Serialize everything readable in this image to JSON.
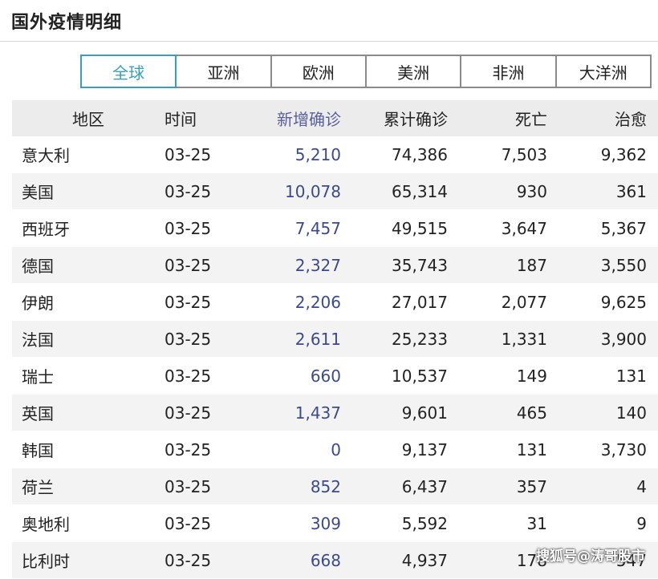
{
  "page": {
    "title": "国外疫情明细"
  },
  "tabs": [
    {
      "label": "全球",
      "active": true
    },
    {
      "label": "亚洲",
      "active": false
    },
    {
      "label": "欧洲",
      "active": false
    },
    {
      "label": "美洲",
      "active": false
    },
    {
      "label": "非洲",
      "active": false
    },
    {
      "label": "大洋洲",
      "active": false
    }
  ],
  "colors": {
    "accent": "#3aa0b8",
    "new_cases": "#3b4a8c",
    "header_bg": "#ececec",
    "row_alt_bg": "#f3f3f3"
  },
  "table": {
    "headers": {
      "region": "地区",
      "time": "时间",
      "new_confirmed": "新增确诊",
      "total_confirmed": "累计确诊",
      "deaths": "死亡",
      "recovered": "治愈"
    },
    "rows": [
      {
        "region": "意大利",
        "time": "03-25",
        "new_confirmed": "5,210",
        "total_confirmed": "74,386",
        "deaths": "7,503",
        "recovered": "9,362"
      },
      {
        "region": "美国",
        "time": "03-25",
        "new_confirmed": "10,078",
        "total_confirmed": "65,314",
        "deaths": "930",
        "recovered": "361"
      },
      {
        "region": "西班牙",
        "time": "03-25",
        "new_confirmed": "7,457",
        "total_confirmed": "49,515",
        "deaths": "3,647",
        "recovered": "5,367"
      },
      {
        "region": "德国",
        "time": "03-25",
        "new_confirmed": "2,327",
        "total_confirmed": "35,743",
        "deaths": "187",
        "recovered": "3,550"
      },
      {
        "region": "伊朗",
        "time": "03-25",
        "new_confirmed": "2,206",
        "total_confirmed": "27,017",
        "deaths": "2,077",
        "recovered": "9,625"
      },
      {
        "region": "法国",
        "time": "03-25",
        "new_confirmed": "2,611",
        "total_confirmed": "25,233",
        "deaths": "1,331",
        "recovered": "3,900"
      },
      {
        "region": "瑞士",
        "time": "03-25",
        "new_confirmed": "660",
        "total_confirmed": "10,537",
        "deaths": "149",
        "recovered": "131"
      },
      {
        "region": "英国",
        "time": "03-25",
        "new_confirmed": "1,437",
        "total_confirmed": "9,601",
        "deaths": "465",
        "recovered": "140"
      },
      {
        "region": "韩国",
        "time": "03-25",
        "new_confirmed": "0",
        "total_confirmed": "9,137",
        "deaths": "131",
        "recovered": "3,730"
      },
      {
        "region": "荷兰",
        "time": "03-25",
        "new_confirmed": "852",
        "total_confirmed": "6,437",
        "deaths": "357",
        "recovered": "4"
      },
      {
        "region": "奥地利",
        "time": "03-25",
        "new_confirmed": "309",
        "total_confirmed": "5,592",
        "deaths": "31",
        "recovered": "9"
      },
      {
        "region": "比利时",
        "time": "03-25",
        "new_confirmed": "668",
        "total_confirmed": "4,937",
        "deaths": "178",
        "recovered": "547"
      }
    ]
  },
  "watermark": "搜狐号@涛哥股市"
}
